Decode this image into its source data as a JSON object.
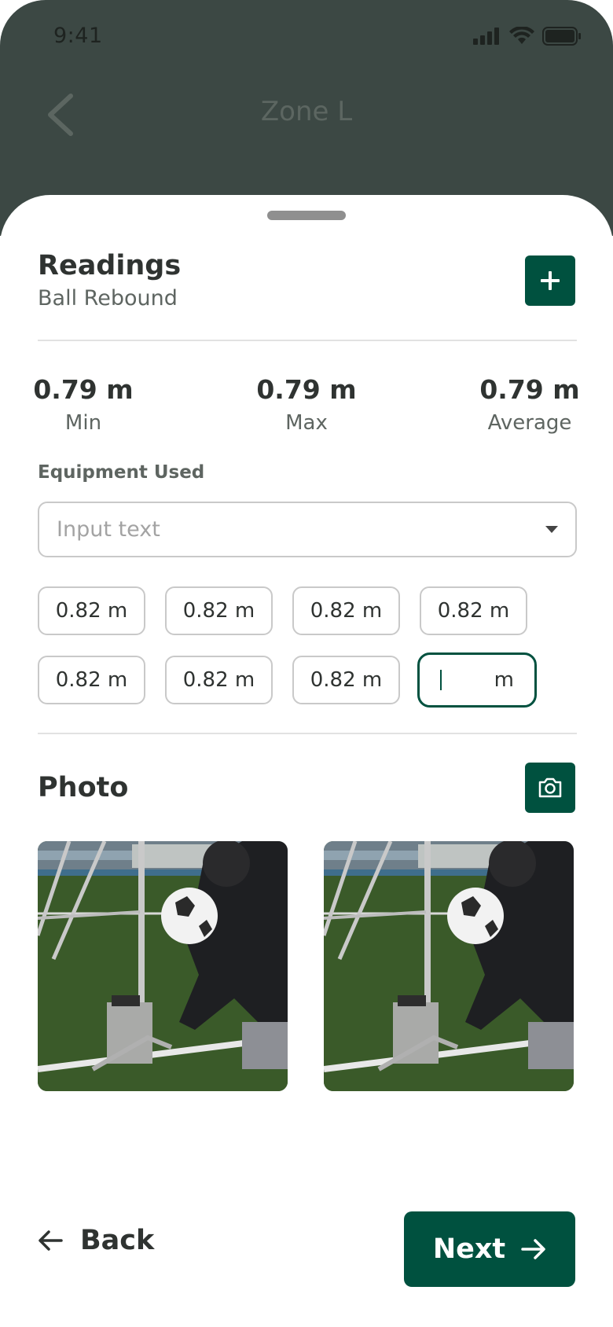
{
  "status_bar": {
    "time": "9:41"
  },
  "nav": {
    "title": "Zone L"
  },
  "readings": {
    "title": "Readings",
    "subtitle": "Ball Rebound"
  },
  "stats": [
    {
      "value": "0.79 m",
      "label": "Min"
    },
    {
      "value": "0.79 m",
      "label": "Max"
    },
    {
      "value": "0.79 m",
      "label": "Average"
    }
  ],
  "equipment": {
    "label": "Equipment Used",
    "placeholder": "Input text"
  },
  "reading_values": [
    "0.82 m",
    "0.82 m",
    "0.82 m",
    "0.82 m",
    "0.82 m",
    "0.82 m",
    "0.82 m"
  ],
  "active_input": {
    "unit": "m"
  },
  "photo": {
    "title": "Photo"
  },
  "footer": {
    "back_label": "Back",
    "next_label": "Next"
  },
  "colors": {
    "accent": "#00513f",
    "header_dim": "#3c4844"
  },
  "icons": [
    "chevron-left-icon",
    "signal-icon",
    "wifi-icon",
    "battery-icon",
    "plus-icon",
    "camera-icon",
    "arrow-left-icon",
    "arrow-right-icon"
  ]
}
